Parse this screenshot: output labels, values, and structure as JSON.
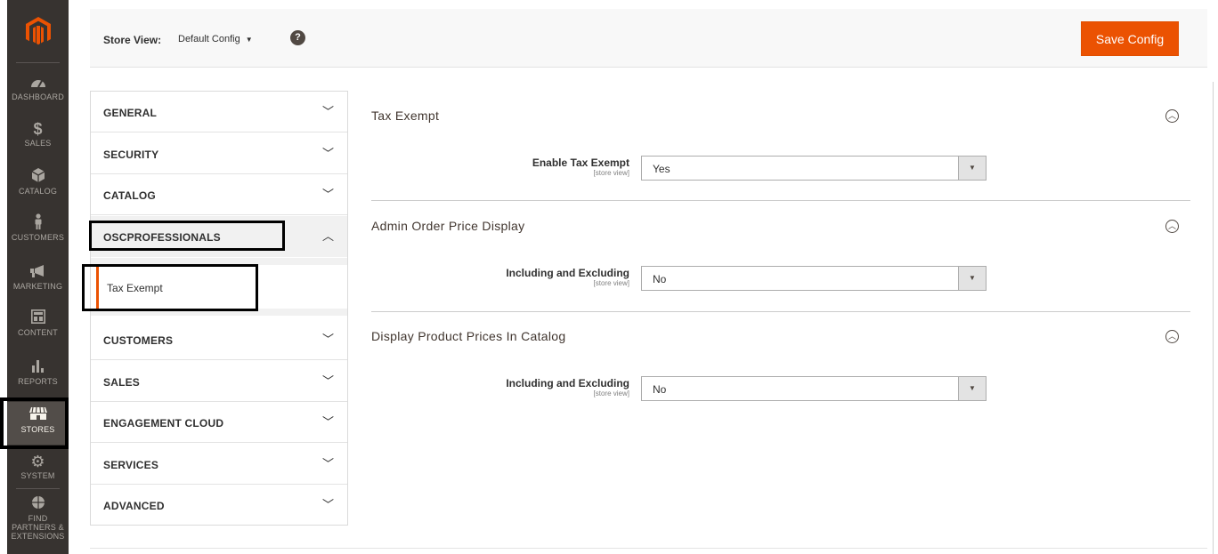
{
  "menu": {
    "items": [
      {
        "label": "DASHBOARD",
        "icon": "dashboard-icon"
      },
      {
        "label": "SALES",
        "icon": "dollar-icon"
      },
      {
        "label": "CATALOG",
        "icon": "cube-icon"
      },
      {
        "label": "CUSTOMERS",
        "icon": "person-icon"
      },
      {
        "label": "MARKETING",
        "icon": "megaphone-icon"
      },
      {
        "label": "CONTENT",
        "icon": "layout-icon"
      },
      {
        "label": "REPORTS",
        "icon": "bar-chart-icon"
      },
      {
        "label": "STORES",
        "icon": "storefront-icon"
      },
      {
        "label": "SYSTEM",
        "icon": "gear-icon"
      },
      {
        "label_lines": [
          "FIND",
          "PARTNERS &",
          "EXTENSIONS"
        ],
        "icon": "box-icon"
      }
    ]
  },
  "store": {
    "label": "Store View:",
    "value": "Default Config",
    "help": "?"
  },
  "toolbar": {
    "save_label": "Save Config"
  },
  "tabs": [
    {
      "label": "GENERAL",
      "chevron": "﹀"
    },
    {
      "label": "SECURITY",
      "chevron": "﹀"
    },
    {
      "label": "CATALOG",
      "chevron": "﹀"
    },
    {
      "label": "OSCPROFESSIONALS",
      "chevron": "︿"
    },
    {
      "label": "CUSTOMERS",
      "chevron": "﹀"
    },
    {
      "label": "SALES",
      "chevron": "﹀"
    },
    {
      "label": "ENGAGEMENT CLOUD",
      "chevron": "﹀"
    },
    {
      "label": "SERVICES",
      "chevron": "﹀"
    },
    {
      "label": "ADVANCED",
      "chevron": "﹀"
    }
  ],
  "subtab": {
    "label": "Tax Exempt"
  },
  "sections": [
    {
      "title": "Tax Exempt",
      "field": {
        "label": "Enable Tax Exempt",
        "scope": "[store view]",
        "value": "Yes"
      }
    },
    {
      "title": "Admin Order Price Display",
      "field": {
        "label": "Including and Excluding",
        "scope": "[store view]",
        "value": "No"
      }
    },
    {
      "title": "Display Product Prices In Catalog",
      "field": {
        "label": "Including and Excluding",
        "scope": "[store view]",
        "value": "No"
      }
    }
  ],
  "colors": {
    "accent": "#eb5202",
    "menu_bg": "#373330"
  }
}
